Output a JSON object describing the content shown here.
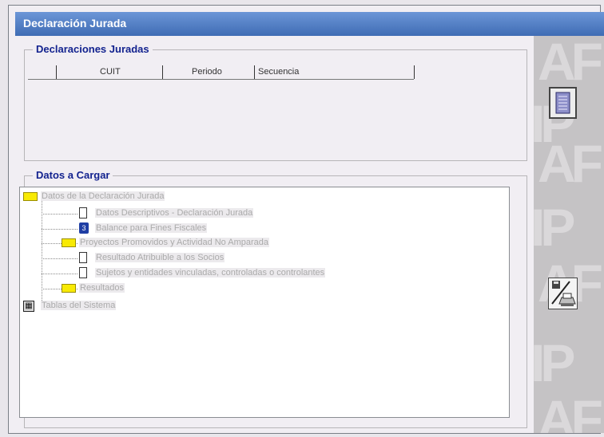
{
  "window": {
    "title": "Declaración Jurada"
  },
  "declaraciones": {
    "legend": "Declaraciones Juradas",
    "columns": [
      "CUIT",
      "Periodo",
      "Secuencia"
    ]
  },
  "datos": {
    "legend": "Datos a Cargar",
    "tree": [
      {
        "label": "Datos de la Declaración Jurada",
        "icon": "folder-icon",
        "level": 0
      },
      {
        "label": "Datos Descriptivos - Declaración Jurada",
        "icon": "document-icon",
        "level": 1
      },
      {
        "label": "Balance para Fines Fiscales",
        "icon": "book-icon",
        "level": 1
      },
      {
        "label": "Proyectos Promovidos y Actividad No Amparada",
        "icon": "folder-icon",
        "level": 1
      },
      {
        "label": "Resultado Atribuible a los Socios",
        "icon": "document-icon",
        "level": 1
      },
      {
        "label": "Sujetos y entidades vinculadas, controladas o controlantes",
        "icon": "document-icon",
        "level": 1
      },
      {
        "label": "Resultados",
        "icon": "folder-icon",
        "level": 1
      },
      {
        "label": "Tablas del Sistema",
        "icon": "calculator-icon",
        "level": 0
      }
    ]
  },
  "side": {
    "watermark": "AFIP",
    "icons": [
      "document-list-icon",
      "save-print-icon"
    ]
  }
}
